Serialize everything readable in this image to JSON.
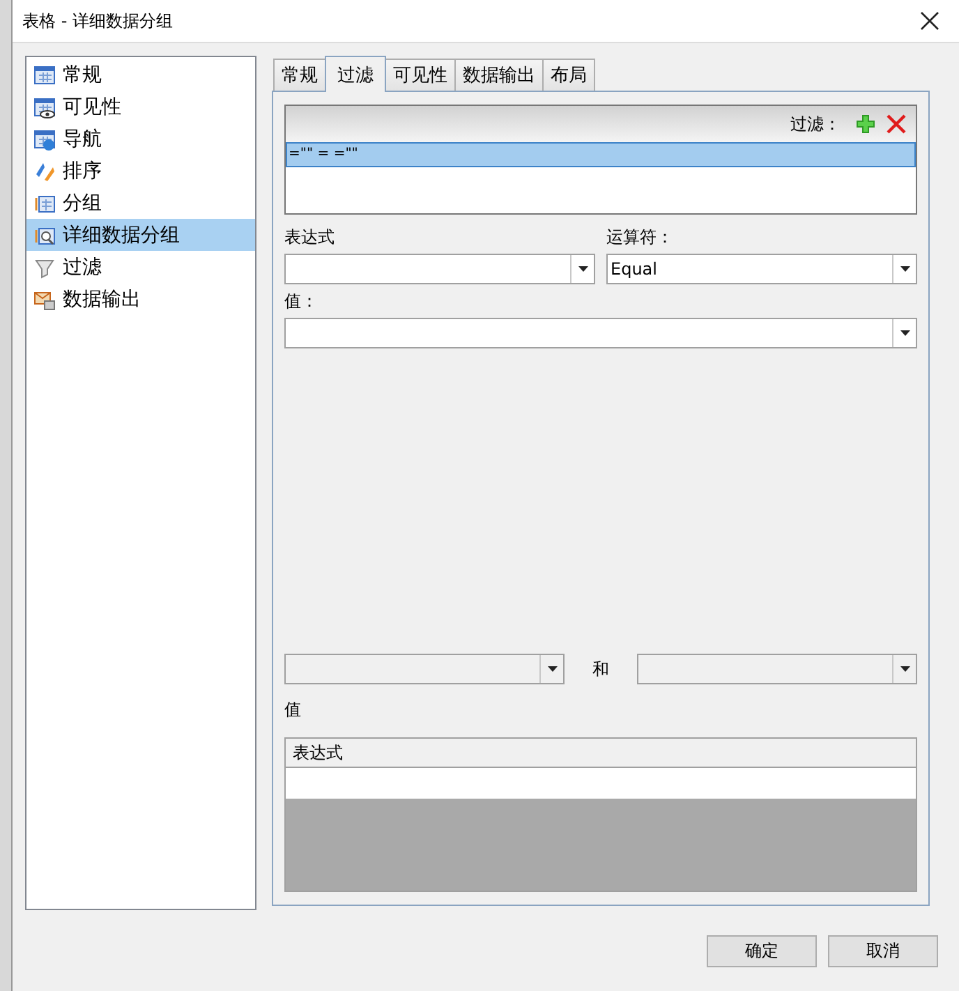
{
  "window": {
    "title": "表格 - 详细数据分组"
  },
  "sidebar": {
    "items": [
      {
        "label": "常规",
        "kind": "general",
        "selected": false
      },
      {
        "label": "可见性",
        "kind": "visibility",
        "selected": false
      },
      {
        "label": "导航",
        "kind": "navigation",
        "selected": false
      },
      {
        "label": "排序",
        "kind": "sort",
        "selected": false
      },
      {
        "label": "分组",
        "kind": "group",
        "selected": false
      },
      {
        "label": "详细数据分组",
        "kind": "detail",
        "selected": true
      },
      {
        "label": "过滤",
        "kind": "filter",
        "selected": false
      },
      {
        "label": "数据输出",
        "kind": "export",
        "selected": false
      }
    ]
  },
  "tabs": [
    {
      "label": "常规",
      "selected": false
    },
    {
      "label": "过滤",
      "selected": true
    },
    {
      "label": "可见性",
      "selected": false
    },
    {
      "label": "数据输出",
      "selected": false
    },
    {
      "label": "布局",
      "selected": false
    }
  ],
  "filter_list": {
    "header": "过滤：",
    "rows": [
      {
        "text": "=\"\" = =\"\"",
        "selected": true
      }
    ]
  },
  "expression": {
    "label": "表达式",
    "disabled": false
  },
  "operator": {
    "label": "运算符：",
    "value": "Equal",
    "disabled": false
  },
  "value": {
    "label": "值：",
    "disabled": false
  },
  "range": {
    "from": {
      "disabled": true
    },
    "separator": "和",
    "to": {
      "disabled": true
    }
  },
  "values_label": "值",
  "values_table": {
    "columns": [
      "表达式"
    ]
  },
  "buttons": [
    "确定",
    "取消"
  ]
}
